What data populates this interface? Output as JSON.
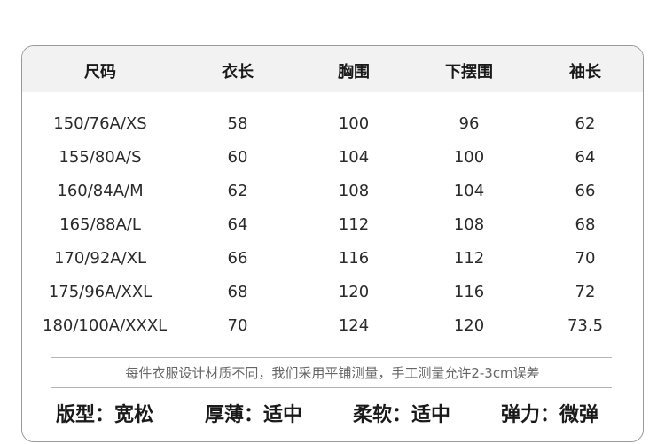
{
  "table": {
    "headers": [
      "尺码",
      "衣长",
      "胸围",
      "下摆围",
      "袖长"
    ],
    "rows": [
      [
        "150/76A/XS",
        "58",
        "100",
        "96",
        "62"
      ],
      [
        "155/80A/S",
        "60",
        "104",
        "100",
        "64"
      ],
      [
        "160/84A/M",
        "62",
        "108",
        "104",
        "66"
      ],
      [
        "165/88A/L",
        "64",
        "112",
        "108",
        "68"
      ],
      [
        "170/92A/XL",
        "66",
        "116",
        "112",
        "70"
      ],
      [
        "175/96A/XXL",
        "68",
        "120",
        "116",
        "72"
      ],
      [
        "180/100A/XXXL",
        "70",
        "124",
        "120",
        "73.5"
      ]
    ]
  },
  "note": "每件衣服设计材质不同，我们采用平铺测量，手工测量允许2-3cm误差",
  "attributes": [
    "版型：宽松",
    "厚薄：适中",
    "柔软：适中",
    "弹力：微弹"
  ]
}
